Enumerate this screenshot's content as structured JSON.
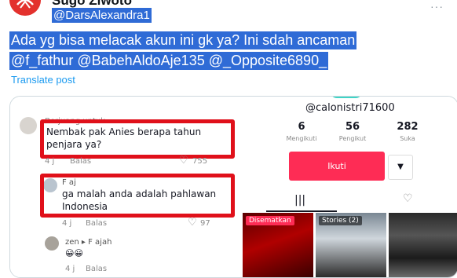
{
  "header": {
    "display_name": "Sugo Ziwoto",
    "handle": "@DarsAlexandra1",
    "more_label": "···"
  },
  "tweet": {
    "line1": "Ada yg bisa melacak akun ini gk ya? Ini sdah ancaman",
    "line2": "@f_fathur @BabehAldoAje135 @_Opposite6890_",
    "translate": "Translate post"
  },
  "comments": {
    "c1_name": "Berjuang untuk...",
    "c1_text": "Nembak pak Anies berapa tahun penjara ya?",
    "c1_time": "4 j",
    "c1_reply": "Balas",
    "c1_likes": "755",
    "c2_name": "F aj",
    "c2_text": "ga malah anda adalah pahlawan Indonesia",
    "c2_time": "4 j",
    "c2_reply": "Balas",
    "c2_likes": "97",
    "c3_name": "zen ▸ F ajah",
    "c3_text": "😀😀",
    "c3_time": "4 j",
    "c3_reply": "Balas"
  },
  "profile": {
    "username": "@calonistri71600",
    "following_count": "6",
    "following_label": "Mengikuti",
    "followers_count": "56",
    "followers_label": "Pengikut",
    "likes_count": "282",
    "likes_label": "Suka",
    "follow_button": "Ikuti",
    "pinned_label": "Disematkan",
    "stories_label": "Stories (2)"
  },
  "colors": {
    "highlight": "#2f6bd6",
    "link": "#1d9bf0",
    "annotation_red": "#e0101a",
    "tiktok_red": "#fe2c55"
  }
}
